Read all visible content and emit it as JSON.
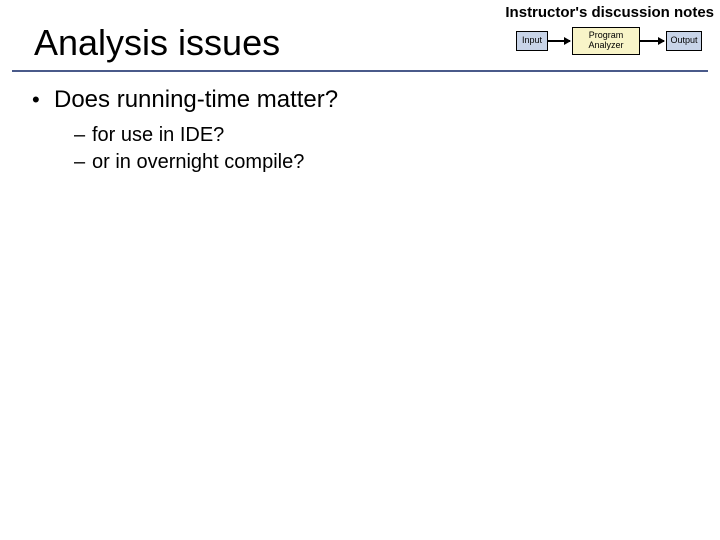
{
  "header_note": "Instructor's discussion notes",
  "title": "Analysis issues",
  "bullets": {
    "main": "Does running-time matter?",
    "sub1": "for use in IDE?",
    "sub2": "or in overnight compile?"
  },
  "diagram": {
    "input_label": "Input",
    "analyzer_label": "Program\nAnalyzer",
    "output_label": "Output"
  }
}
